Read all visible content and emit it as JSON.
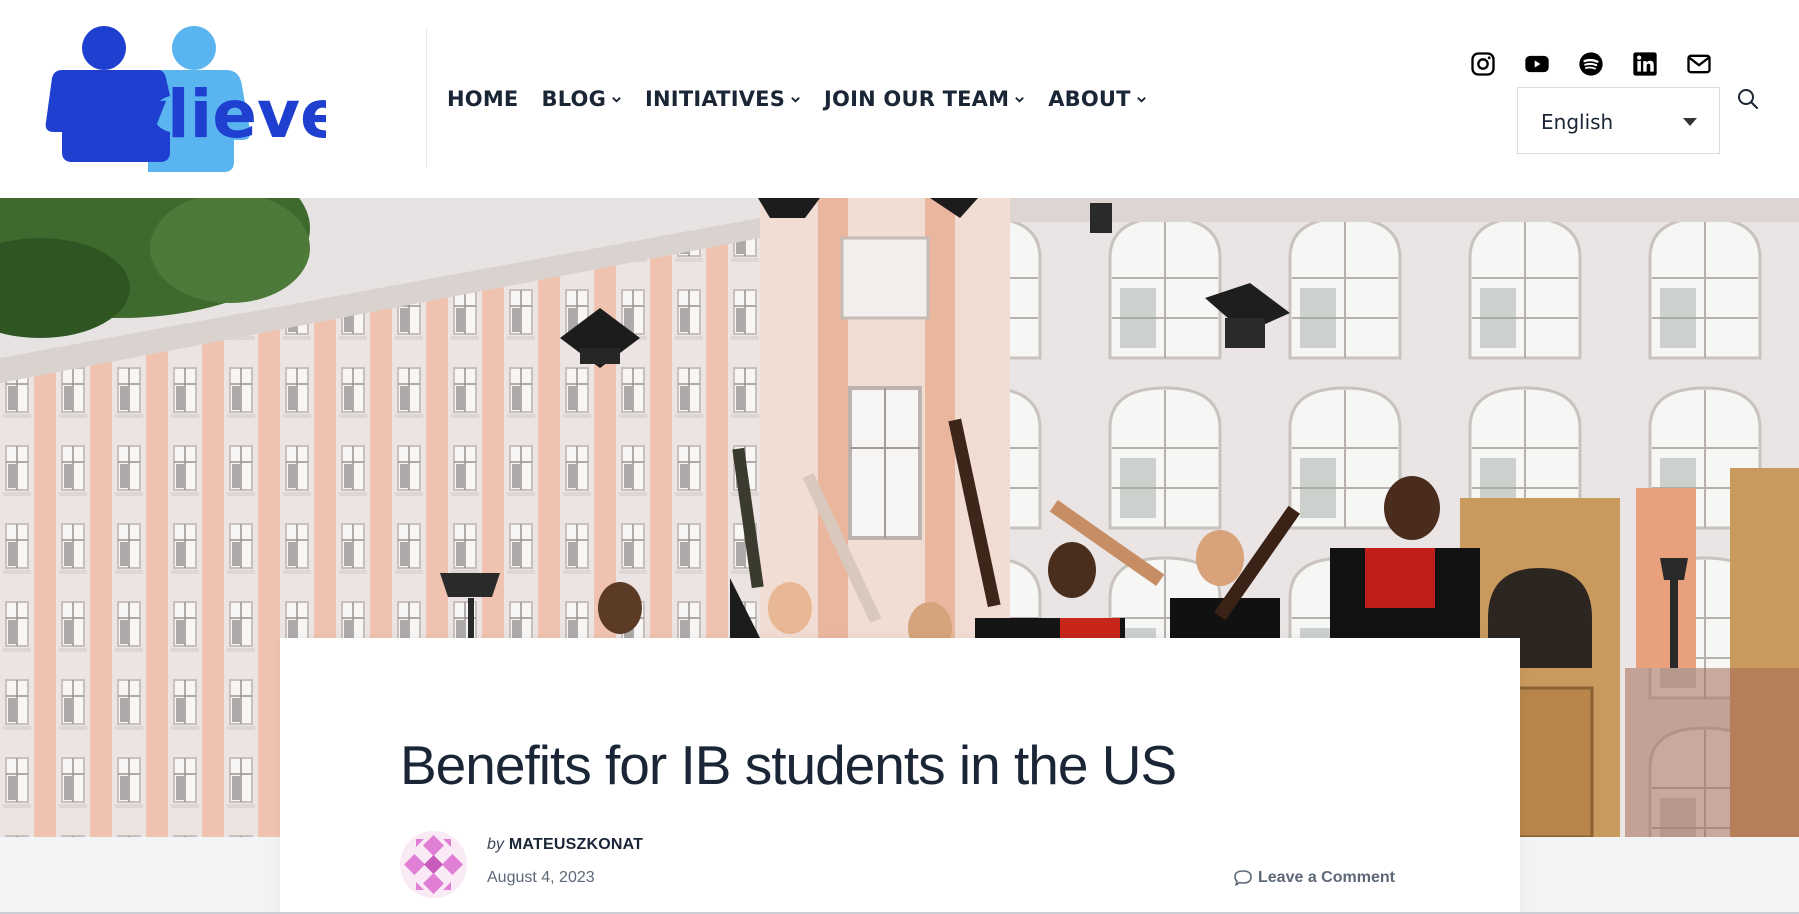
{
  "header": {
    "logo": {
      "text": "vlieve",
      "name": "site-logo"
    },
    "nav": [
      {
        "label": "HOME",
        "has_dropdown": false
      },
      {
        "label": "BLOG",
        "has_dropdown": true
      },
      {
        "label": "INITIATIVES",
        "has_dropdown": true
      },
      {
        "label": "JOIN OUR TEAM",
        "has_dropdown": true
      },
      {
        "label": "ABOUT",
        "has_dropdown": true
      }
    ],
    "social_icons": [
      "instagram-icon",
      "youtube-icon",
      "spotify-icon",
      "linkedin-icon",
      "mail-icon"
    ],
    "language": {
      "selected": "English"
    },
    "search_icon": "search-icon"
  },
  "hero": {
    "image": "graduates throwing caps in front of university building"
  },
  "post": {
    "title": "Benefits for IB students in the US",
    "by_label": "by",
    "author": "MATEUSZKONAT",
    "date": "August 4, 2023",
    "comment_label": "Leave a Comment"
  },
  "colors": {
    "brand_dark_blue": "#1e3fd0",
    "brand_light_blue": "#5ab4f0",
    "text_dark": "#1a2536",
    "text_muted": "#5d6878",
    "avatar_pink": "#e07fd3"
  }
}
